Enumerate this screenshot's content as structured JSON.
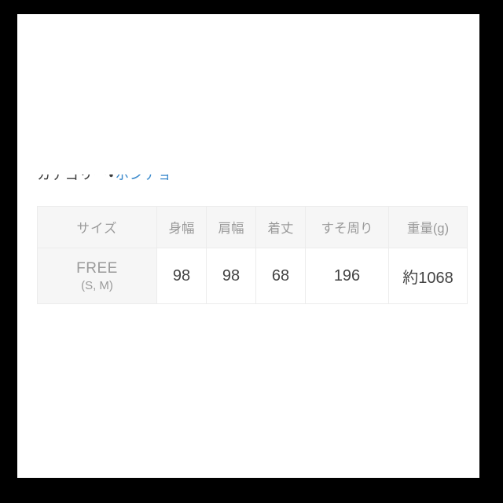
{
  "page": {
    "background_color": "#ffffff",
    "frame_color": "#000000"
  },
  "category": {
    "label": "カテゴリー",
    "separator": "・",
    "link_text": "ポンチョ",
    "link_color": "#3d8bcd",
    "text_color": "#3a3a3a"
  },
  "size_table": {
    "header_background": "#f6f6f6",
    "header_text_color": "#9a9a9a",
    "cell_text_color": "#434343",
    "border_color": "#ececec",
    "columns": [
      {
        "key": "size",
        "label": "サイズ"
      },
      {
        "key": "bust",
        "label": "身幅"
      },
      {
        "key": "shoulder",
        "label": "肩幅"
      },
      {
        "key": "length",
        "label": "着丈"
      },
      {
        "key": "hem",
        "label": "すそ周り"
      },
      {
        "key": "weight",
        "label": "重量(g)"
      }
    ],
    "rows": [
      {
        "size_main": "FREE",
        "size_sub": "(S, M)",
        "bust": "98",
        "shoulder": "98",
        "length": "68",
        "hem": "196",
        "weight": "約1068"
      }
    ]
  }
}
